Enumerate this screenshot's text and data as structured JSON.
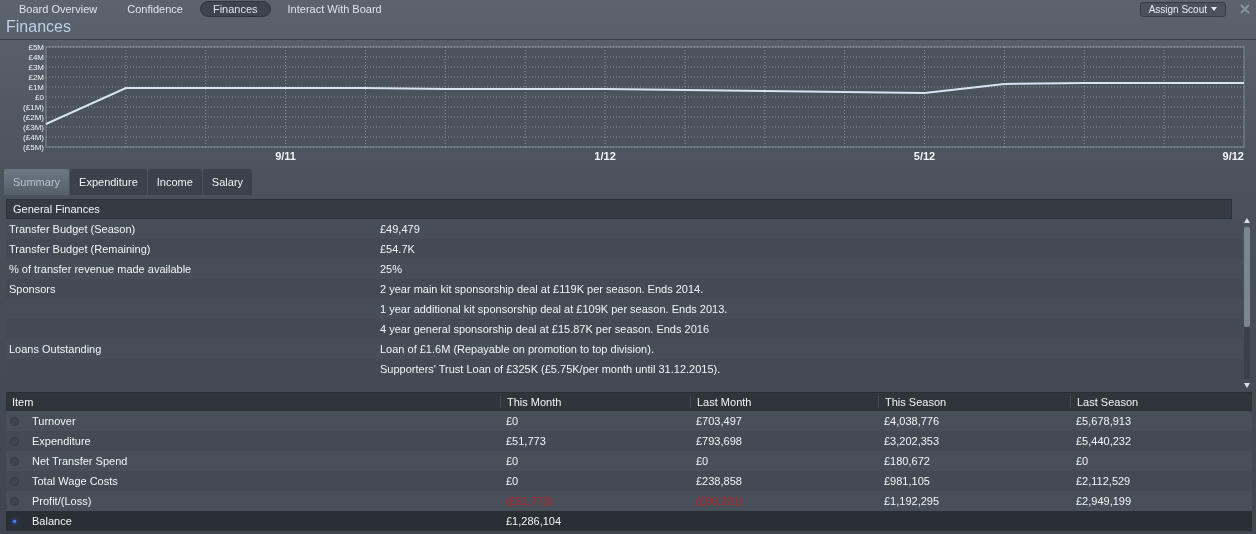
{
  "top_tabs": [
    {
      "label": "Board Overview",
      "selected": false
    },
    {
      "label": "Confidence",
      "selected": false
    },
    {
      "label": "Finances",
      "selected": true
    },
    {
      "label": "Interact With Board",
      "selected": false
    }
  ],
  "assign_button": {
    "label": "Assign Scout"
  },
  "title": "Finances",
  "chart": {
    "x_axis_labels": [
      "9/11",
      "1/12",
      "5/12",
      "9/12"
    ],
    "chart_data": {
      "type": "line",
      "grid": true,
      "ylim": [
        -5,
        5
      ],
      "yticks": [
        {
          "value": 5,
          "label": "£5M"
        },
        {
          "value": 4,
          "label": "£4M"
        },
        {
          "value": 3,
          "label": "£3M"
        },
        {
          "value": 2,
          "label": "£2M"
        },
        {
          "value": 1,
          "label": "£1M"
        },
        {
          "value": 0,
          "label": "£0"
        },
        {
          "value": -1,
          "label": "(£1M)"
        },
        {
          "value": -2,
          "label": "(£2M)"
        },
        {
          "value": -3,
          "label": "(£3M)"
        },
        {
          "value": -4,
          "label": "(£4M)"
        },
        {
          "value": -5,
          "label": "(£5M)"
        }
      ],
      "series": [
        {
          "color": "#d8e2f0",
          "values": [
            -2.7,
            0.9,
            0.9,
            0.9,
            0.9,
            0.8,
            0.8,
            0.8,
            0.7,
            0.6,
            0.5,
            0.4,
            1.3,
            1.4,
            1.4,
            1.4
          ]
        }
      ]
    }
  },
  "tabs": [
    {
      "label": "Summary",
      "selected": true
    },
    {
      "label": "Expenditure",
      "selected": false
    },
    {
      "label": "Income",
      "selected": false
    },
    {
      "label": "Salary",
      "selected": false
    }
  ],
  "general": {
    "heading": "General Finances",
    "rows": [
      {
        "label": "Transfer Budget (Season)",
        "value": "£49,479"
      },
      {
        "label": "Transfer Budget (Remaining)",
        "value": "£54.7K"
      },
      {
        "label": "% of transfer revenue made available",
        "value": "25%"
      },
      {
        "label": "Sponsors",
        "value": "2 year main kit sponsorship deal at £119K per season. Ends 2014."
      },
      {
        "value": "1 year additional kit sponsorship deal at £109K per season. Ends 2013."
      },
      {
        "value": "4 year general sponsorship deal at £15.87K per season. Ends 2016"
      },
      {
        "label": "Loans Outstanding",
        "value": "Loan of £1.6M (Repayable on promotion to top division)."
      },
      {
        "value": "Supporters' Trust Loan of £325K (£5.75K/per month until 31.12.2015)."
      }
    ]
  },
  "table": {
    "columns": [
      "Item",
      "This Month",
      "Last Month",
      "This Season",
      "Last Season"
    ],
    "rows": [
      {
        "selected": false,
        "cells": [
          {
            "text": "Turnover"
          },
          {
            "text": "£0"
          },
          {
            "text": "£703,497"
          },
          {
            "text": "£4,038,776"
          },
          {
            "text": "£5,678,913"
          }
        ]
      },
      {
        "selected": false,
        "cells": [
          {
            "text": "Expenditure"
          },
          {
            "text": "£51,773"
          },
          {
            "text": "£793,698"
          },
          {
            "text": "£3,202,353"
          },
          {
            "text": "£5,440,232"
          }
        ]
      },
      {
        "selected": false,
        "cells": [
          {
            "text": "Net Transfer Spend"
          },
          {
            "text": "£0"
          },
          {
            "text": "£0"
          },
          {
            "text": "£180,672"
          },
          {
            "text": "£0"
          }
        ]
      },
      {
        "selected": false,
        "cells": [
          {
            "text": "Total Wage Costs"
          },
          {
            "text": "£0"
          },
          {
            "text": "£238,858"
          },
          {
            "text": "£981,105"
          },
          {
            "text": "£2,112,529"
          }
        ]
      },
      {
        "selected": false,
        "cells": [
          {
            "text": "Profit/(Loss)"
          },
          {
            "text": "(£51,773)",
            "negative": true
          },
          {
            "text": "(£90,201)",
            "negative": true
          },
          {
            "text": "£1,192,295"
          },
          {
            "text": "£2,949,199"
          }
        ]
      },
      {
        "selected": true,
        "cells": [
          {
            "text": "Balance"
          },
          {
            "text": "£1,286,104"
          }
        ]
      }
    ]
  }
}
